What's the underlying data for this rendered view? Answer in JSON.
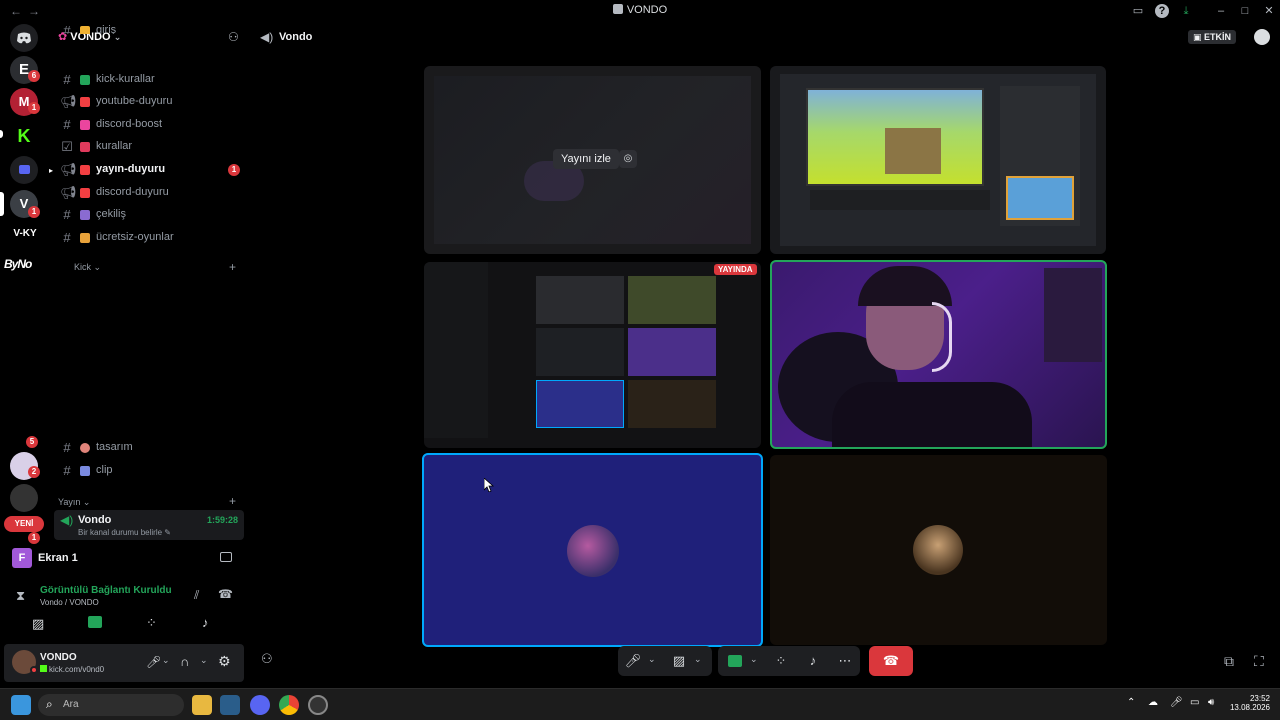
{
  "window": {
    "title": "VONDO",
    "back_arrow": "←",
    "fwd_arrow": "→"
  },
  "rail": {
    "badges": [
      "6",
      "1",
      "1",
      "5",
      "2",
      "1"
    ],
    "vky_label": "V-KY",
    "bygn_label": "ByNo",
    "new_label": "YENİ"
  },
  "sidebar": {
    "guild_name": "VONDO",
    "channels_top": [
      {
        "label": "giriş",
        "emoji_color": "#f0b232",
        "type": "text"
      },
      {
        "label": "kick-kurallar",
        "emoji_color": "#23a55a",
        "type": "text"
      },
      {
        "label": "youtube-duyuru",
        "emoji_color": "#f23f42",
        "type": "announce"
      },
      {
        "label": "discord-boost",
        "emoji_color": "#eb459e",
        "type": "text"
      },
      {
        "label": "kurallar",
        "emoji_color": "#e03a5c",
        "type": "rules"
      },
      {
        "label": "yayın-duyuru",
        "emoji_color": "#f23f42",
        "type": "announce",
        "unread": true,
        "mention": "1"
      },
      {
        "label": "discord-duyuru",
        "emoji_color": "#f23f42",
        "type": "announce"
      },
      {
        "label": "çekiliş",
        "emoji_color": "#8a6bd1",
        "type": "text"
      },
      {
        "label": "ücretsiz-oyunlar",
        "emoji_color": "#e8a23a",
        "type": "text"
      }
    ],
    "category_kick": "Kick",
    "channels_bottom": [
      {
        "label": "tasarım",
        "emoji_color": "#e0847a"
      },
      {
        "label": "clip",
        "emoji_color": "#7a8ae0"
      }
    ],
    "category_yayin": "Yayın",
    "voice_channel": {
      "name": "Vondo",
      "timer": "1:59:28",
      "status": "Bir kanal durumu belirle"
    },
    "stream_label": "Ekran 1",
    "stream_avatar_letter": "F"
  },
  "voice": {
    "status": "Görüntülü Bağlantı Kuruldu",
    "location": "Vondo / VONDO"
  },
  "user": {
    "name": "VONDO",
    "activity": "kick.com/v0nd0"
  },
  "main": {
    "channel_name": "Vondo",
    "active_label": "ETKİN",
    "watch_stream": "Yayını izle",
    "live_badge": "YAYINDA"
  },
  "taskbar": {
    "search_placeholder": "Ara",
    "time": "23:52",
    "date": "13.08.2026"
  }
}
